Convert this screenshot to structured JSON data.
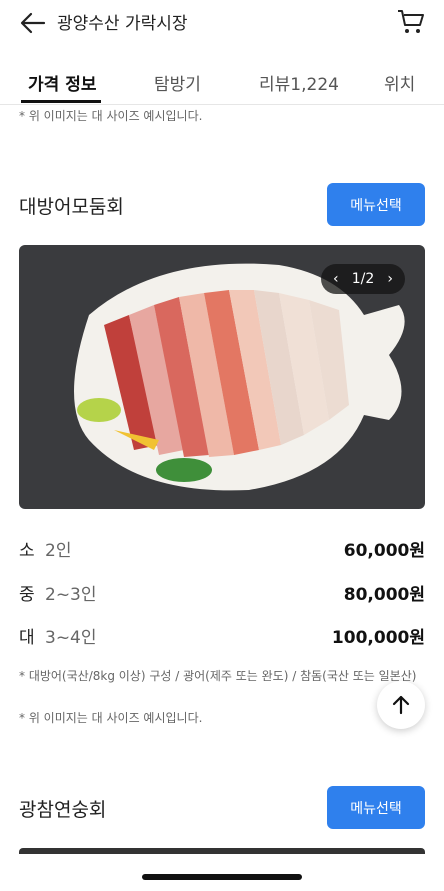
{
  "header": {
    "title": "광양수산 가락시장",
    "back_icon": "arrow-left-icon",
    "cart_icon": "cart-icon"
  },
  "tabs": [
    {
      "label": "가격 정보",
      "active": true
    },
    {
      "label": "탐방기",
      "active": false
    },
    {
      "label": "리뷰1,224",
      "active": false
    },
    {
      "label": "위치",
      "active": false
    }
  ],
  "top_note": "* 위 이미지는 대 사이즈 예시입니다.",
  "section1": {
    "title": "대방어모둠회",
    "button": "메뉴선택",
    "pager": "1/2",
    "options": [
      {
        "size": "소",
        "people": "2인",
        "price": "60,000원"
      },
      {
        "size": "중",
        "people": "2~3인",
        "price": "80,000원"
      },
      {
        "size": "대",
        "people": "3~4인",
        "price": "100,000원"
      }
    ],
    "note1": "* 대방어(국산/8kg 이상) 구성 / 광어(제주 또는 완도) / 참돔(국산 또는 일본산)",
    "note2": "* 위 이미지는 대 사이즈 예시입니다."
  },
  "section2": {
    "title": "광참연숭회",
    "button": "메뉴선택"
  },
  "colors": {
    "accent": "#2f80ed",
    "photo_bg": "#3a3b3e"
  }
}
